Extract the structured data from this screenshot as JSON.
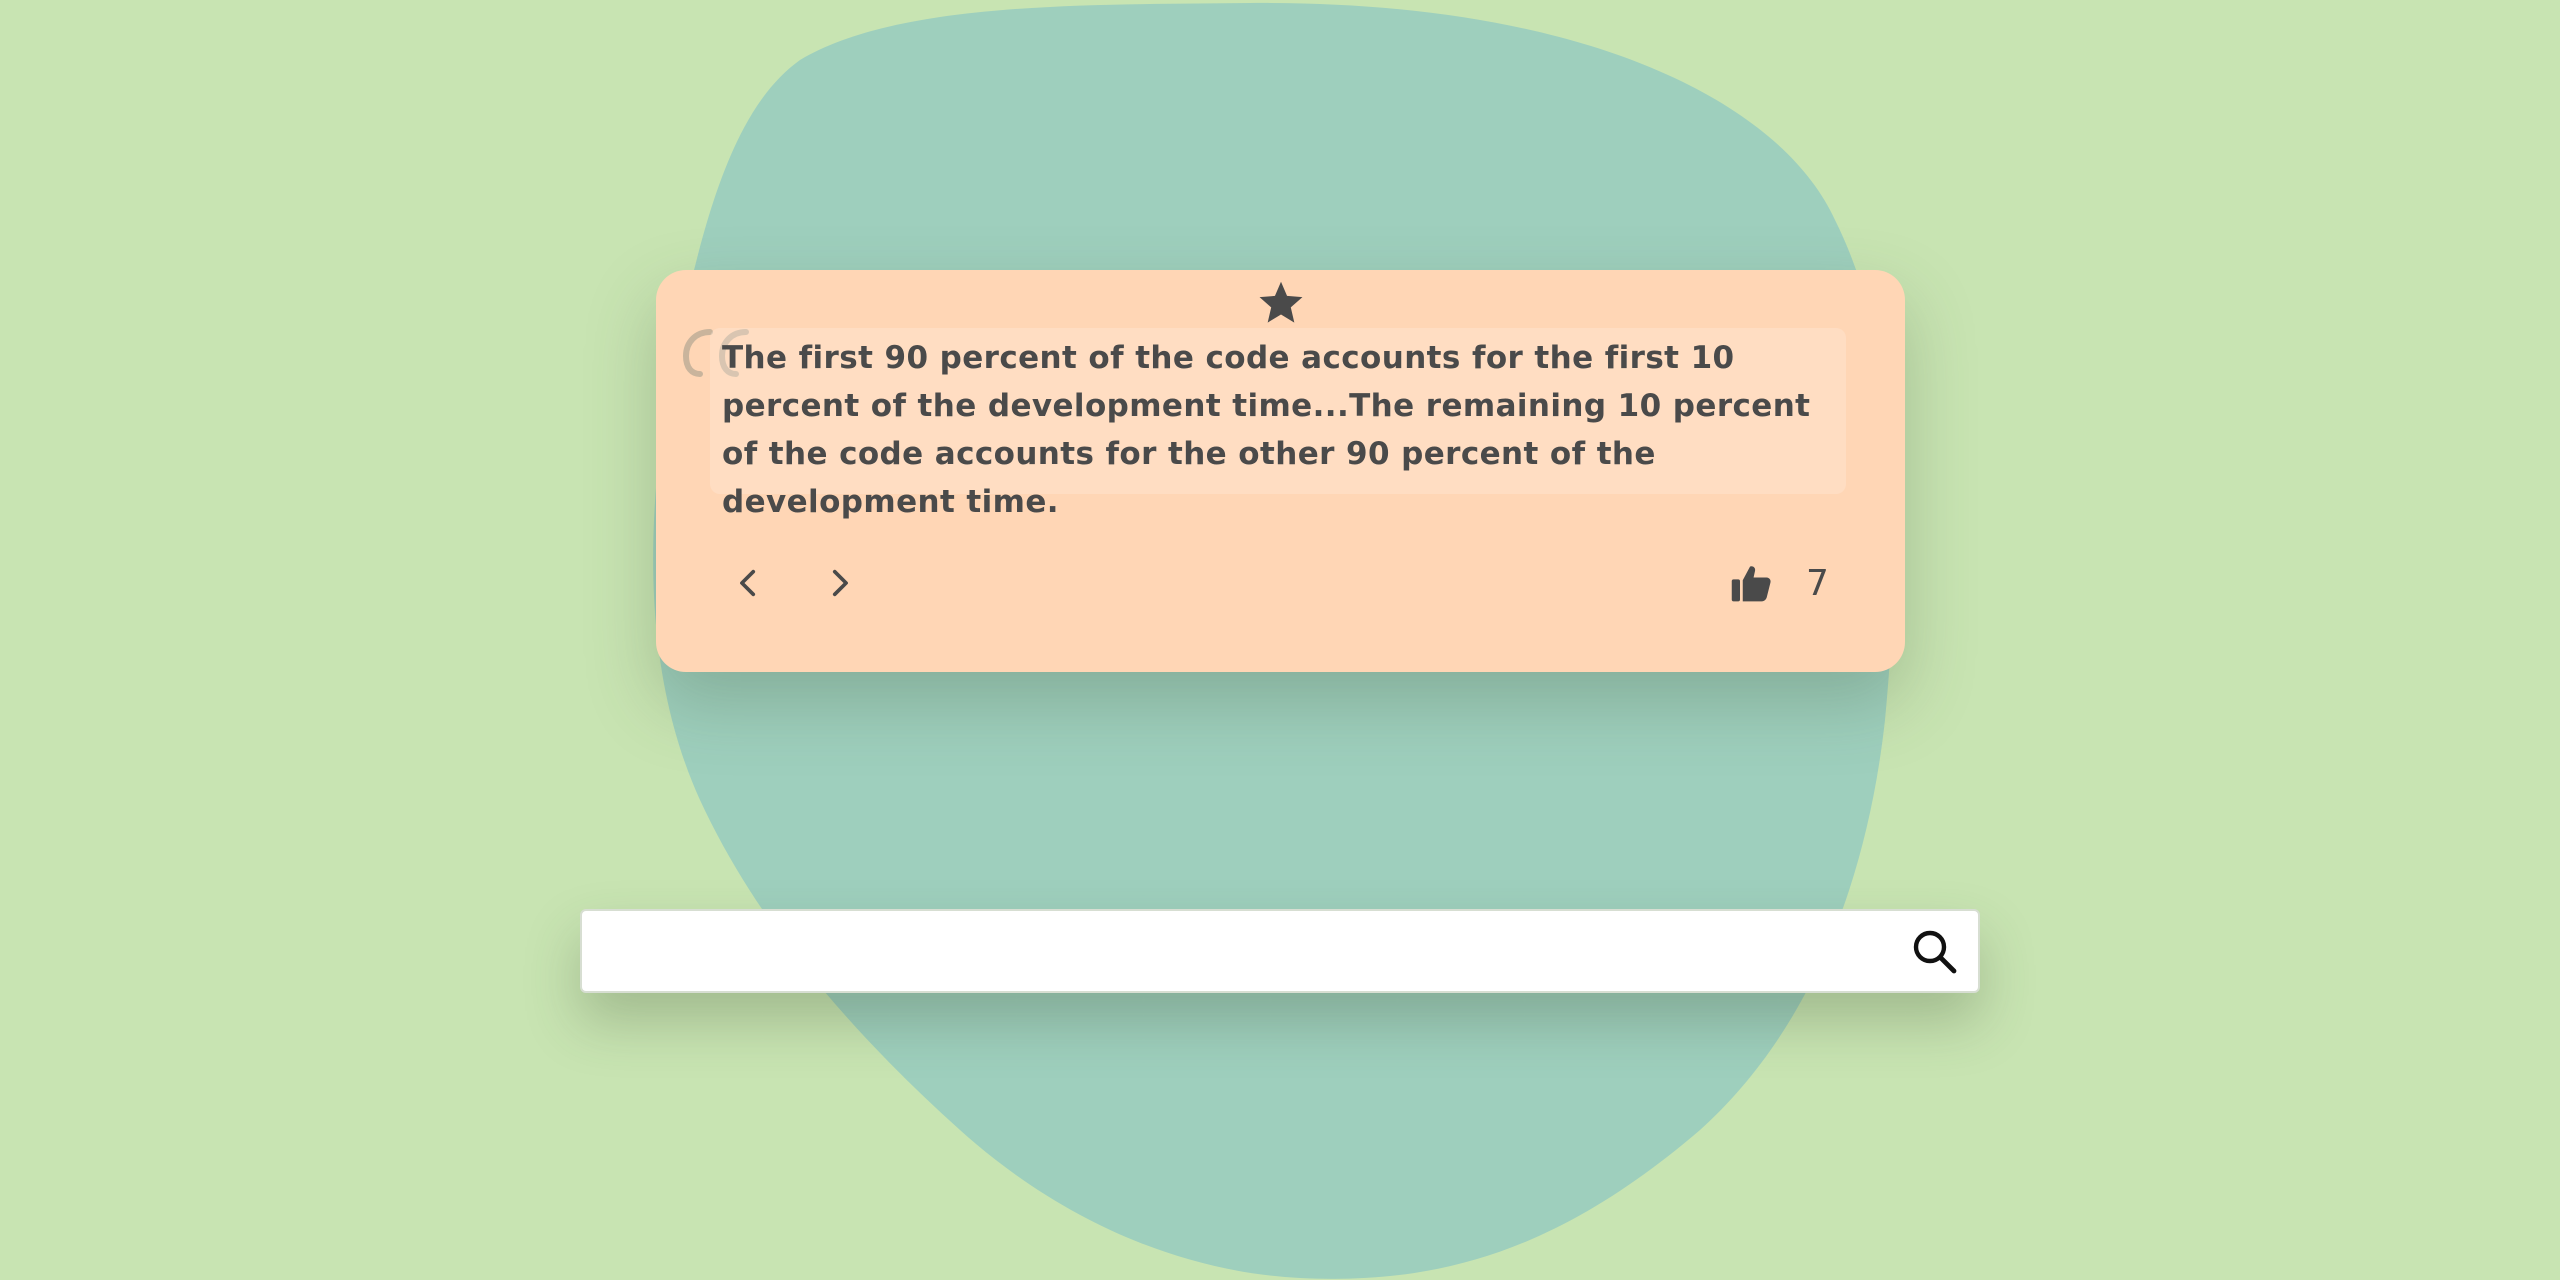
{
  "colors": {
    "background": "#c8e4b2",
    "blob": "#9ecfbd",
    "card": "#ffd6b5",
    "text": "#4a4a4a"
  },
  "quote": {
    "text": "The first 90 percent of the code accounts for the first 10 percent of the development time...The remaining 10 percent of the code accounts for the other 90 percent of the development time.",
    "likes": "7"
  },
  "icons": {
    "favorite": "star-icon",
    "quote": "quote-mark-icon",
    "previous": "chevron-left-icon",
    "next": "chevron-right-icon",
    "like": "thumbs-up-icon",
    "search": "search-icon"
  },
  "search": {
    "value": "",
    "placeholder": ""
  }
}
